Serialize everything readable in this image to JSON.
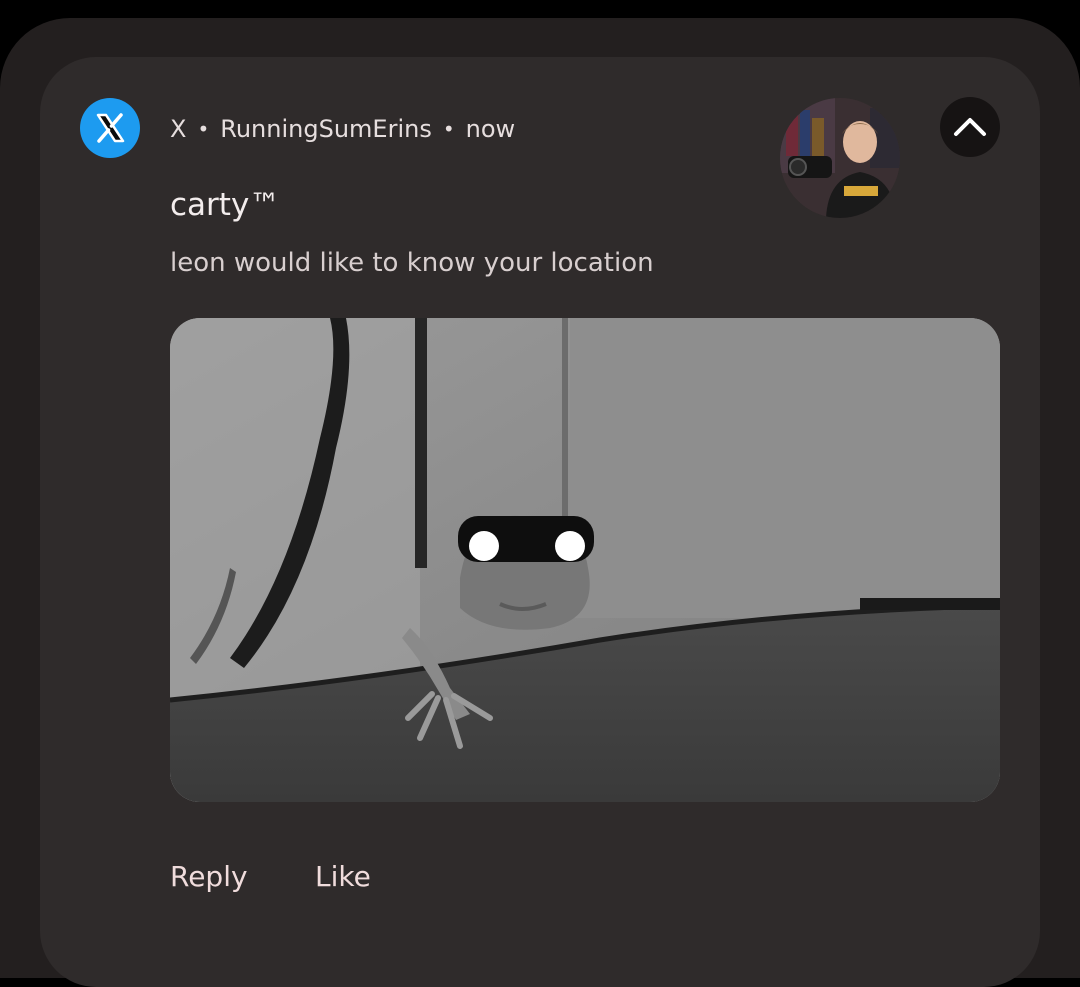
{
  "notification": {
    "app_name": "X",
    "separator": "•",
    "account": "RunningSumErins",
    "time": "now",
    "title": "carty™",
    "body": "leon would like to know your location",
    "app_icon": "x-logo-icon",
    "collapse_icon": "chevron-up-icon",
    "actions": [
      {
        "label": "Reply"
      },
      {
        "label": "Like"
      }
    ]
  },
  "colors": {
    "app_icon_bg": "#1d9bf0",
    "card_bg": "#2f2b2b",
    "outer_bg": "#231f1f"
  }
}
